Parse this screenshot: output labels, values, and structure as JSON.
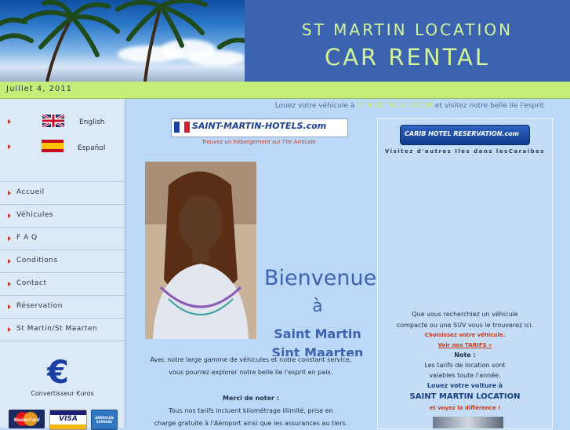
{
  "header": {
    "brand_line1": "ST MARTIN LOCATION",
    "brand_line2": "CAR RENTAL"
  },
  "date": "Juillet 4, 2011",
  "languages": [
    {
      "label": "English",
      "flag": "uk"
    },
    {
      "label": "Español",
      "flag": "spain"
    }
  ],
  "nav": [
    {
      "label": "Accueil"
    },
    {
      "label": "Véhicules"
    },
    {
      "label": "F A Q"
    },
    {
      "label": "Conditions"
    },
    {
      "label": "Contact"
    },
    {
      "label": "Réservation"
    },
    {
      "label": "St Martin/St Maarten"
    }
  ],
  "tagline": {
    "pre": "Louez votre véhicule à ",
    "highlight": "ST MARTIN LOCATION",
    "post": " et visitez notre belle Ile l'esprit"
  },
  "left_banner": {
    "text": "SAINT-MARTIN-HOTELS.com",
    "caption": "Trouvez un hébergement sur l'Ile Amicale"
  },
  "right_banner": {
    "text": "CARIB HOTEL RESERVATION.com",
    "caption": "Visitez d'autres Iles dans lesCaraibes"
  },
  "welcome": {
    "line1": "Bienvenue",
    "line2": "à",
    "line3": "Saint Martin",
    "line4": "Sint Maarten"
  },
  "body_lines": [
    "Avec notre large gamme de véhicules et notre constant service,",
    "vous pourrez explorer notre belle Ile l'esprit en paix.",
    "Merci de noter :",
    "Tous nos tarifs incluent kilométrage illimité, prise en",
    "charge gratuite à l'Aéroport ainsi que les assurances au tiers."
  ],
  "right_panel": {
    "line1": "Que vous recherchiez un véhicule",
    "line2": "compacte ou une SUV vous le trouverez ici.",
    "choose": "Choisissez votre véhicule.",
    "tariffs_link": "Voir nos TARIFS »",
    "note_title": "Note :",
    "note1": "Les tarifs de location sont",
    "note2": "valables toute l'année.",
    "rent": "Louez votre voiture à",
    "brand": "SAINT MARTIN LOCATION",
    "difference": "et voyez la différence !"
  },
  "sidebar_footer": {
    "converter_label": "Convertisseur €uros",
    "cards": [
      "MasterCard",
      "VISA",
      "AMERICAN EXPRESS"
    ]
  },
  "colors": {
    "header_bg": "#3c63b0",
    "brand_text": "#d4f49a",
    "date_strip": "#c5ee79",
    "page_bg": "#bcd8f8",
    "accent_red": "#cc3b1a",
    "welcome_blue": "#3d63b0"
  }
}
